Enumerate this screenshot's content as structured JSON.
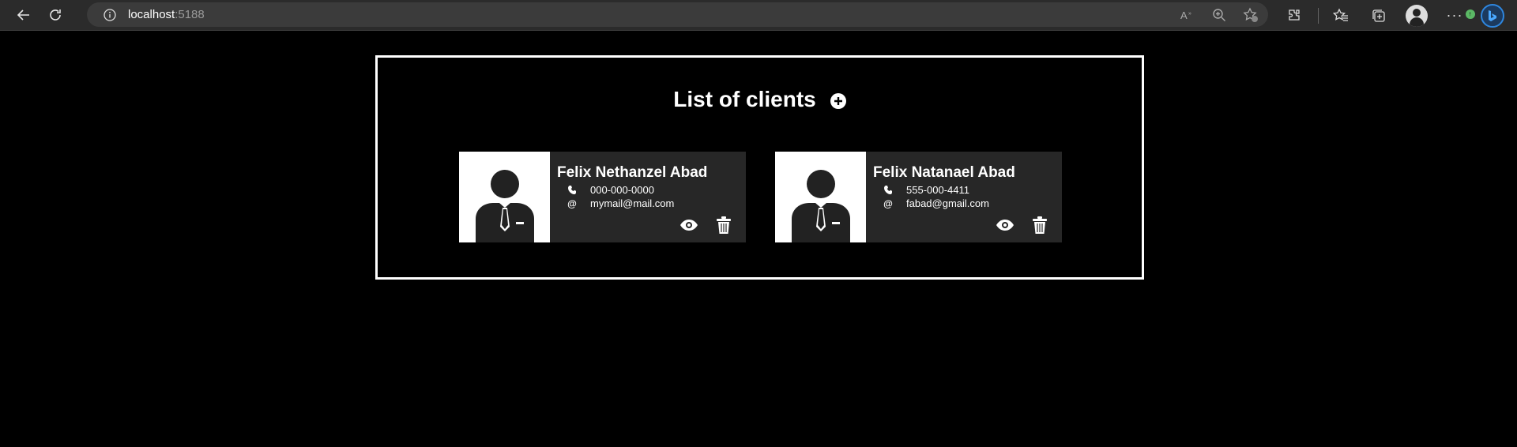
{
  "browser": {
    "host": "localhost",
    "port": ":5188"
  },
  "page": {
    "title": "List of clients"
  },
  "clients": [
    {
      "name": "Felix Nethanzel Abad",
      "phone": "000-000-0000",
      "email": "mymail@mail.com"
    },
    {
      "name": "Felix Natanael Abad",
      "phone": "555-000-4411",
      "email": "fabad@gmail.com"
    }
  ],
  "colors": {
    "background": "#000000",
    "card": "#272727",
    "accent": "#ffffff"
  },
  "icons": {
    "add": "plus-circle-icon",
    "view": "eye-icon",
    "delete": "trash-icon",
    "phone": "phone-icon",
    "email": "at-icon"
  }
}
